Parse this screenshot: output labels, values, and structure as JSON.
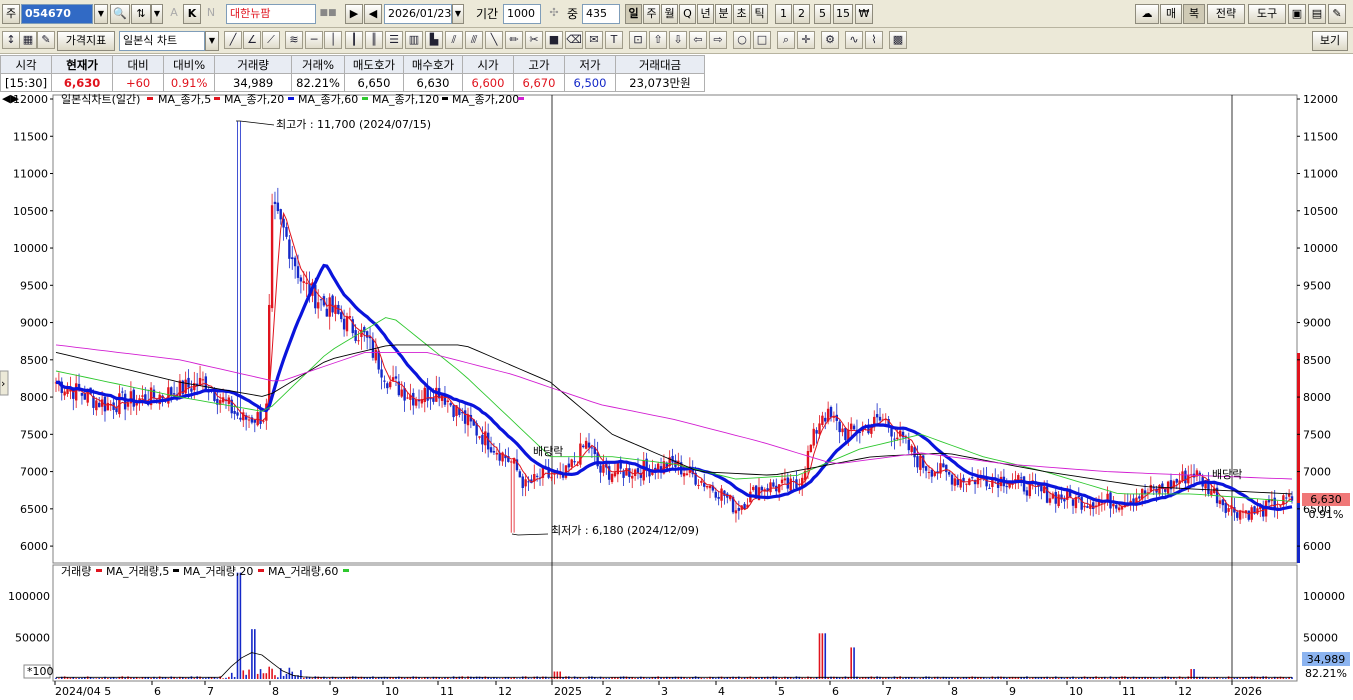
{
  "toolbar": {
    "type_label": "주",
    "code": "054670",
    "name": "대한뉴팜",
    "date": "2026/01/23",
    "period_label": "기간",
    "period_value": "1000",
    "count_label": "중",
    "count_value": "435",
    "periods": [
      "일",
      "주",
      "월",
      "Q",
      "년",
      "분",
      "초",
      "틱",
      "1",
      "2",
      "5",
      "15"
    ],
    "right_buttons": [
      "매",
      "복",
      "전략",
      "도구"
    ],
    "letters": [
      "A",
      "K",
      "N"
    ],
    "view_button": "보기"
  },
  "toolbar2": {
    "indicator_btn": "가격지표",
    "chart_type": "일본식 차트"
  },
  "quote": {
    "headers": [
      "시각",
      "현재가",
      "대비",
      "대비%",
      "거래량",
      "거래%",
      "매도호가",
      "매수호가",
      "시가",
      "고가",
      "저가",
      "거래대금"
    ],
    "values": [
      "[15:30]",
      "6,630",
      "+60",
      "0.91%",
      "34,989",
      "82.21%",
      "6,650",
      "6,630",
      "6,600",
      "6,670",
      "6,500",
      "23,073만원"
    ]
  },
  "legend_price": [
    "일본식차트(일간)",
    "MA_종가,5",
    "MA_종가,20",
    "MA_종가,60",
    "MA_종가,120",
    "MA_종가,200"
  ],
  "legend_volume": [
    "거래량",
    "MA_거래량,5",
    "MA_거래량,20",
    "MA_거래량,60"
  ],
  "colors": {
    "up": "#e0141e",
    "down": "#1428c8",
    "ma5": "#e0141e",
    "ma20": "#0a14dc",
    "ma60": "#2ec82e",
    "ma120": "#000000",
    "ma200": "#d21ed2"
  },
  "annotations": {
    "high": "최고가 : 11,700 (2024/07/15)",
    "low": "최저가 : 6,180 (2024/12/09)",
    "div1": "배당락",
    "div2": "배당락",
    "vol_unit": "*100"
  },
  "right_badges": {
    "price": "6,630",
    "pct": "0.91%",
    "volume": "34,989",
    "volume_pct": "82.21%"
  },
  "chart_data": {
    "type": "line",
    "price_axis": {
      "ylim": [
        5800,
        12000
      ],
      "ticks": [
        12000,
        11500,
        11000,
        10500,
        10000,
        9500,
        9000,
        8500,
        8000,
        7500,
        7000,
        6500,
        6000
      ]
    },
    "volume_axis": {
      "ticks": [
        100000,
        50000
      ]
    },
    "x_labels": [
      "2024/04 5",
      "6",
      "7",
      "8",
      "9",
      "10",
      "11",
      "12",
      "2025",
      "2",
      "3",
      "4",
      "5",
      "6",
      "7",
      "8",
      "9",
      "10",
      "11",
      "12",
      "2026"
    ],
    "close_series_anchors": [
      [
        0,
        8200
      ],
      [
        0.04,
        7900
      ],
      [
        0.08,
        8000
      ],
      [
        0.12,
        8200
      ],
      [
        0.15,
        7700
      ],
      [
        0.17,
        7750
      ],
      [
        0.175,
        10500
      ],
      [
        0.185,
        10200
      ],
      [
        0.2,
        9500
      ],
      [
        0.22,
        9200
      ],
      [
        0.25,
        8800
      ],
      [
        0.27,
        8200
      ],
      [
        0.29,
        8000
      ],
      [
        0.31,
        8100
      ],
      [
        0.33,
        7700
      ],
      [
        0.35,
        7400
      ],
      [
        0.37,
        7100
      ],
      [
        0.38,
        6800
      ],
      [
        0.395,
        6950
      ],
      [
        0.41,
        6900
      ],
      [
        0.43,
        7400
      ],
      [
        0.44,
        7000
      ],
      [
        0.46,
        7000
      ],
      [
        0.5,
        7100
      ],
      [
        0.52,
        6900
      ],
      [
        0.54,
        6700
      ],
      [
        0.55,
        6500
      ],
      [
        0.57,
        6800
      ],
      [
        0.6,
        6800
      ],
      [
        0.62,
        7800
      ],
      [
        0.64,
        7500
      ],
      [
        0.67,
        7700
      ],
      [
        0.7,
        7100
      ],
      [
        0.73,
        6900
      ],
      [
        0.77,
        6900
      ],
      [
        0.8,
        6700
      ],
      [
        0.83,
        6600
      ],
      [
        0.86,
        6600
      ],
      [
        0.9,
        6800
      ],
      [
        0.92,
        7000
      ],
      [
        0.95,
        6500
      ],
      [
        0.97,
        6450
      ],
      [
        1.0,
        6630
      ]
    ],
    "ma_series": [
      {
        "name": "MA_종가,60",
        "anchors": [
          [
            0,
            8350
          ],
          [
            0.1,
            8000
          ],
          [
            0.17,
            7800
          ],
          [
            0.22,
            8600
          ],
          [
            0.27,
            9100
          ],
          [
            0.33,
            8300
          ],
          [
            0.4,
            7200
          ],
          [
            0.45,
            7200
          ],
          [
            0.5,
            7100
          ],
          [
            0.55,
            6900
          ],
          [
            0.6,
            6950
          ],
          [
            0.65,
            7300
          ],
          [
            0.7,
            7500
          ],
          [
            0.75,
            7200
          ],
          [
            0.8,
            7000
          ],
          [
            0.86,
            6700
          ],
          [
            0.92,
            6700
          ],
          [
            1.0,
            6600
          ]
        ]
      },
      {
        "name": "MA_종가,120",
        "anchors": [
          [
            0,
            8600
          ],
          [
            0.1,
            8200
          ],
          [
            0.17,
            8000
          ],
          [
            0.22,
            8500
          ],
          [
            0.27,
            8700
          ],
          [
            0.33,
            8700
          ],
          [
            0.4,
            8200
          ],
          [
            0.45,
            7500
          ],
          [
            0.52,
            7000
          ],
          [
            0.58,
            6950
          ],
          [
            0.66,
            7200
          ],
          [
            0.72,
            7250
          ],
          [
            0.8,
            7000
          ],
          [
            0.88,
            6800
          ],
          [
            0.94,
            6750
          ],
          [
            1.0,
            6700
          ]
        ]
      },
      {
        "name": "MA_종가,200",
        "anchors": [
          [
            0,
            8700
          ],
          [
            0.1,
            8500
          ],
          [
            0.18,
            8200
          ],
          [
            0.25,
            8600
          ],
          [
            0.3,
            8600
          ],
          [
            0.37,
            8300
          ],
          [
            0.44,
            7900
          ],
          [
            0.5,
            7700
          ],
          [
            0.57,
            7400
          ],
          [
            0.63,
            7100
          ],
          [
            0.7,
            7250
          ],
          [
            0.77,
            7100
          ],
          [
            0.85,
            7000
          ],
          [
            0.92,
            6950
          ],
          [
            1.0,
            6900
          ]
        ]
      }
    ]
  }
}
